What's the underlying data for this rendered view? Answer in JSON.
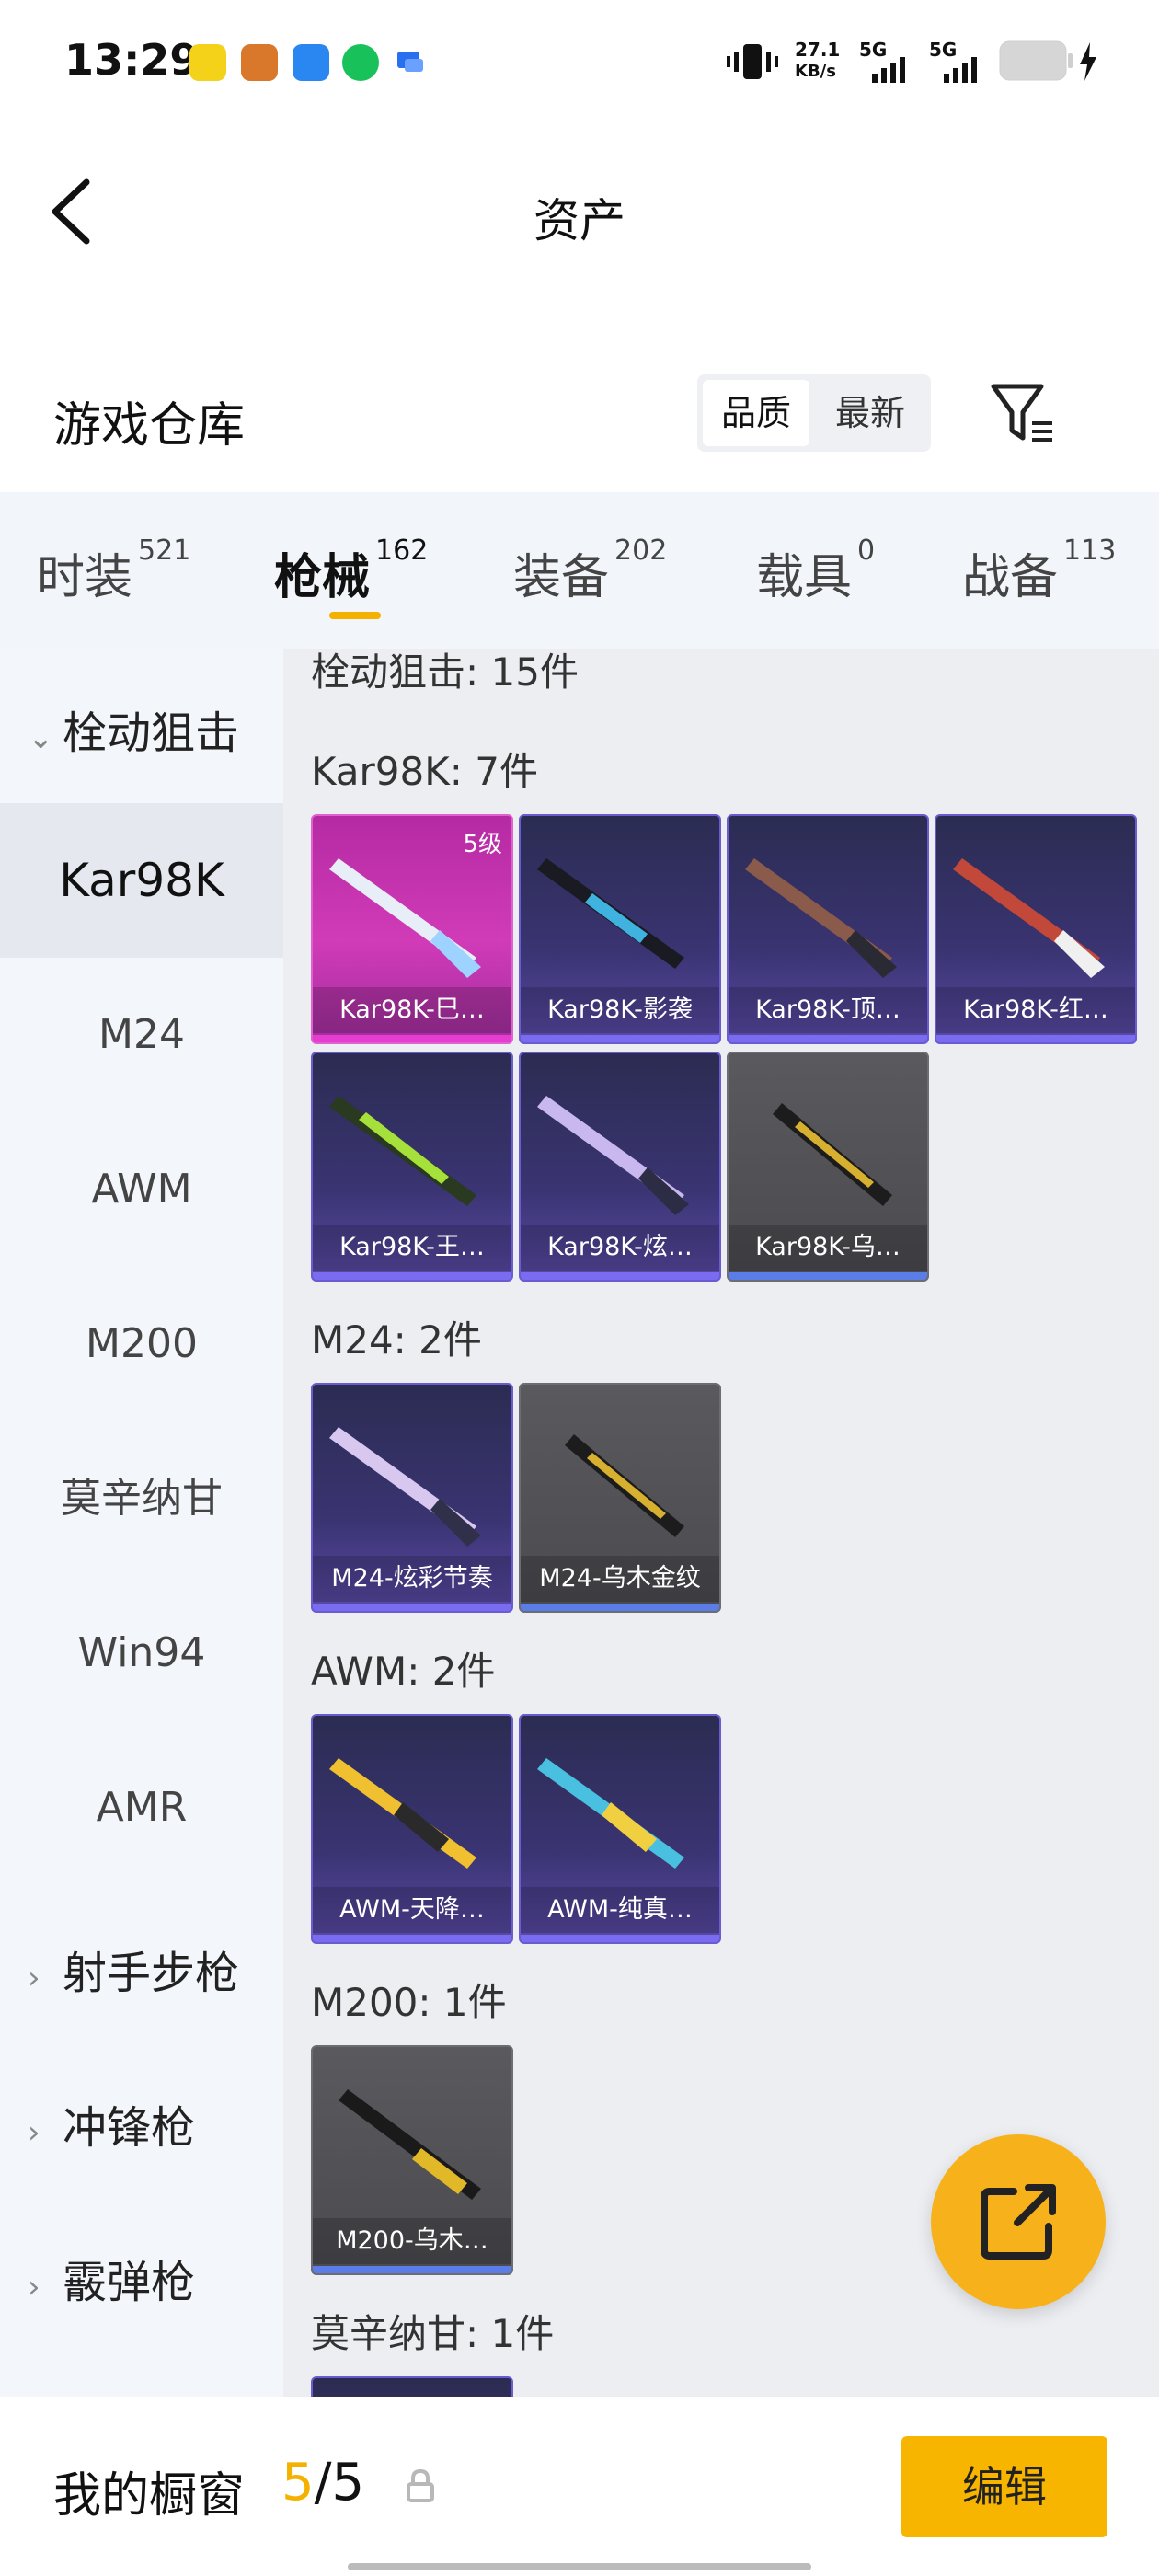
{
  "status_bar": {
    "time": "13:29",
    "net_speed_value": "27.1",
    "net_speed_unit": "KB/s",
    "signal1": "5G",
    "signal2": "5G"
  },
  "header": {
    "title": "资产"
  },
  "warehouse": {
    "title": "游戏仓库",
    "sort_options": [
      "品质",
      "最新"
    ]
  },
  "tabs": [
    {
      "label": "时装",
      "count": "521"
    },
    {
      "label": "枪械",
      "count": "162"
    },
    {
      "label": "装备",
      "count": "202"
    },
    {
      "label": "载具",
      "count": "0"
    },
    {
      "label": "战备",
      "count": "113"
    }
  ],
  "sidebar": {
    "group_open": "栓动狙击",
    "items": [
      "Kar98K",
      "M24",
      "AWM",
      "M200",
      "莫辛纳甘",
      "Win94",
      "AMR"
    ],
    "groups_closed": [
      "射手步枪",
      "冲锋枪",
      "霰弹枪"
    ]
  },
  "content": {
    "top_header": "栓动狙击: 15件",
    "sections": [
      {
        "title": "Kar98K: 7件",
        "cards": [
          {
            "label": "Kar98K-巳…",
            "level": "5级"
          },
          {
            "label": "Kar98K-影袭"
          },
          {
            "label": "Kar98K-顶…"
          },
          {
            "label": "Kar98K-红…"
          },
          {
            "label": "Kar98K-王…"
          },
          {
            "label": "Kar98K-炫…"
          },
          {
            "label": "Kar98K-乌…"
          }
        ]
      },
      {
        "title": "M24: 2件",
        "cards": [
          {
            "label": "M24-炫彩节奏"
          },
          {
            "label": "M24-乌木金纹"
          }
        ]
      },
      {
        "title": "AWM: 2件",
        "cards": [
          {
            "label": "AWM-天降…"
          },
          {
            "label": "AWM-纯真…"
          }
        ]
      },
      {
        "title": "M200: 1件",
        "cards": [
          {
            "label": "M200-乌木…"
          }
        ]
      },
      {
        "title": "莫辛纳甘: 1件",
        "cards": []
      }
    ]
  },
  "bottom": {
    "showcase_label": "我的橱窗",
    "showcase_current": "5",
    "showcase_total": "/5",
    "edit_label": "编辑"
  },
  "colors": {
    "accent": "#f7b500",
    "tab_bar_bg": "#f2f5fa",
    "rarity_purple": "#6a5bd0",
    "rarity_pink": "#d13bb8",
    "rarity_gray": "#5a5a5e"
  }
}
